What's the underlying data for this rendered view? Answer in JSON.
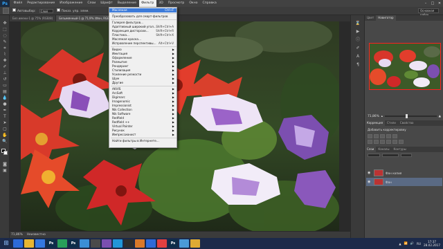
{
  "menubar": {
    "logo": "Ps",
    "items": [
      "Файл",
      "Редактирование",
      "Изображение",
      "Слои",
      "Шрифт",
      "Выделение",
      "Фильтр",
      "3D",
      "Просмотр",
      "Окно",
      "Справка"
    ],
    "active_index": 6
  },
  "options": {
    "checkbox1": "Автовыбор:",
    "field1": "Слой",
    "checkbox2": "Показ. упр. элем.",
    "workspace": "Основная рабоч"
  },
  "tabs": [
    {
      "label": "Без имени-1 @ 75% (RGB/8)",
      "active": false
    },
    {
      "label": "Безымянный-1 @ 71,9% (Фон, RGB/8*)",
      "active": true
    }
  ],
  "filter_menu": {
    "items": [
      {
        "label": "Масляная",
        "shortcut": "Ctrl+F",
        "highlighted": true
      },
      {
        "sep": true
      },
      {
        "label": "Преобразовать для смарт-фильтров"
      },
      {
        "sep": true
      },
      {
        "label": "Галерея фильтров..."
      },
      {
        "label": "Адаптивный широкий угол...",
        "shortcut": "Shift+Ctrl+A"
      },
      {
        "label": "Коррекция дисторсии...",
        "shortcut": "Shift+Ctrl+R"
      },
      {
        "label": "Пластика...",
        "shortcut": "Shift+Ctrl+X"
      },
      {
        "label": "Масляная краска..."
      },
      {
        "label": "Исправление перспективы...",
        "shortcut": "Alt+Ctrl+V"
      },
      {
        "sep": true
      },
      {
        "label": "Видео",
        "submenu": true
      },
      {
        "label": "Имитация",
        "submenu": true
      },
      {
        "label": "Оформление",
        "submenu": true
      },
      {
        "label": "Размытие",
        "submenu": true
      },
      {
        "label": "Рендеринг",
        "submenu": true
      },
      {
        "label": "Стилизация",
        "submenu": true
      },
      {
        "label": "Усиление резкости",
        "submenu": true
      },
      {
        "label": "Шум",
        "submenu": true
      },
      {
        "label": "Другие",
        "submenu": true
      },
      {
        "sep": true
      },
      {
        "label": "AKVIS",
        "submenu": true
      },
      {
        "label": "ArcSoft",
        "submenu": true
      },
      {
        "label": "Digimarc",
        "submenu": true
      },
      {
        "label": "Imagenomic",
        "submenu": true
      },
      {
        "label": "Impressionist",
        "submenu": true
      },
      {
        "label": "Nik Collection",
        "submenu": true
      },
      {
        "label": "Nik Software",
        "submenu": true
      },
      {
        "label": "Redfield",
        "submenu": true
      },
      {
        "label": "Redfield ++",
        "submenu": true
      },
      {
        "label": "Virtual Painter",
        "submenu": true
      },
      {
        "label": "Рисунок",
        "submenu": true
      },
      {
        "label": "Импрессионист",
        "submenu": true
      },
      {
        "sep": true
      },
      {
        "label": "Найти фильтры в Интернете..."
      }
    ]
  },
  "status": {
    "zoom": "71,86%",
    "doc": "Неизвестно"
  },
  "right_panel": {
    "top_tabs": [
      "Цвет",
      "Навигатор"
    ],
    "zoom_value": "71,86%",
    "mid_tabs": [
      "Коррекция",
      "Стили",
      "Свойства"
    ],
    "adjust_hint": "Добавить корректировку",
    "layer_tabs": [
      "Слои",
      "Каналы",
      "Контуры"
    ],
    "layers": [
      {
        "name": "Фон копия",
        "selected": false
      },
      {
        "name": "Фон",
        "selected": true
      }
    ]
  },
  "taskbar": {
    "apps": [
      {
        "label": "",
        "color": "#2d6ad8"
      },
      {
        "label": "",
        "color": "#e8b631"
      },
      {
        "label": "",
        "color": "#3478e0"
      },
      {
        "label": "Ps",
        "color": "#0d2d4a"
      },
      {
        "label": "",
        "color": "#28a05a"
      },
      {
        "label": "Ps",
        "color": "#0d2d4a"
      },
      {
        "label": "",
        "color": "#3b8ed6"
      },
      {
        "label": "",
        "color": "#4a4a4a"
      },
      {
        "label": "",
        "color": "#7a4fb0"
      },
      {
        "label": "",
        "color": "#2196d8"
      },
      {
        "label": "",
        "color": "#2d2d2d"
      },
      {
        "label": "",
        "color": "#d9792a"
      },
      {
        "label": "",
        "color": "#2d6ad8"
      },
      {
        "label": "",
        "color": "#e04040"
      },
      {
        "label": "Ps",
        "color": "#0d2d4a"
      },
      {
        "label": "",
        "color": "#4a9ad8"
      },
      {
        "label": "",
        "color": "#ddaa33"
      }
    ],
    "lang": "RU",
    "time": "17:37",
    "date": "28.02.2017"
  }
}
